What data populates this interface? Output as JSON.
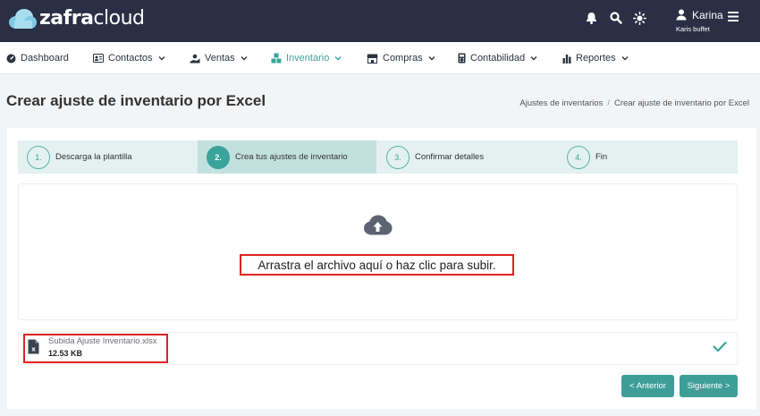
{
  "app": {
    "logo_bold": "zafra",
    "logo_light": "cloud"
  },
  "user": {
    "name": "Karina",
    "company": "Karis buffet"
  },
  "topbar_icons": [
    "bell-icon",
    "search-icon",
    "sun-icon",
    "user-icon",
    "menu-icon"
  ],
  "nav": {
    "items": [
      {
        "label": "Dashboard",
        "icon": "dashboard-icon",
        "dropdown": false
      },
      {
        "label": "Contactos",
        "icon": "contacts-icon",
        "dropdown": true
      },
      {
        "label": "Ventas",
        "icon": "sales-icon",
        "dropdown": true
      },
      {
        "label": "Inventario",
        "icon": "inventory-icon",
        "dropdown": true,
        "active": true
      },
      {
        "label": "Compras",
        "icon": "store-icon",
        "dropdown": true
      },
      {
        "label": "Contabilidad",
        "icon": "calculator-icon",
        "dropdown": true
      },
      {
        "label": "Reportes",
        "icon": "bar-chart-icon",
        "dropdown": true
      }
    ]
  },
  "page": {
    "title": "Crear ajuste de inventario por Excel",
    "breadcrumb": [
      "Ajustes de inventarios",
      "Crear ajuste de inventario por Excel"
    ],
    "breadcrumb_sep": "/"
  },
  "stepper": {
    "steps": [
      {
        "num": "1.",
        "label": "Descarga la plantilla"
      },
      {
        "num": "2.",
        "label": "Crea tus ajustes de inventario",
        "active": true
      },
      {
        "num": "3.",
        "label": "Confirmar detalles"
      },
      {
        "num": "4.",
        "label": "Fin"
      }
    ]
  },
  "upload": {
    "message": "Arrastra el archivo aquí o haz clic para subir.",
    "icon": "cloud-upload-icon"
  },
  "file": {
    "name": "Subida Ajuste Inventario.xlsx",
    "size": "12.53 KB",
    "icon": "excel-file-icon",
    "status_icon": "check-icon"
  },
  "buttons": {
    "previous": "< Anterior",
    "next": "Siguiente >"
  },
  "colors": {
    "topbar": "#2a2f45",
    "accent": "#3aa39b",
    "highlight": "#e02222"
  }
}
